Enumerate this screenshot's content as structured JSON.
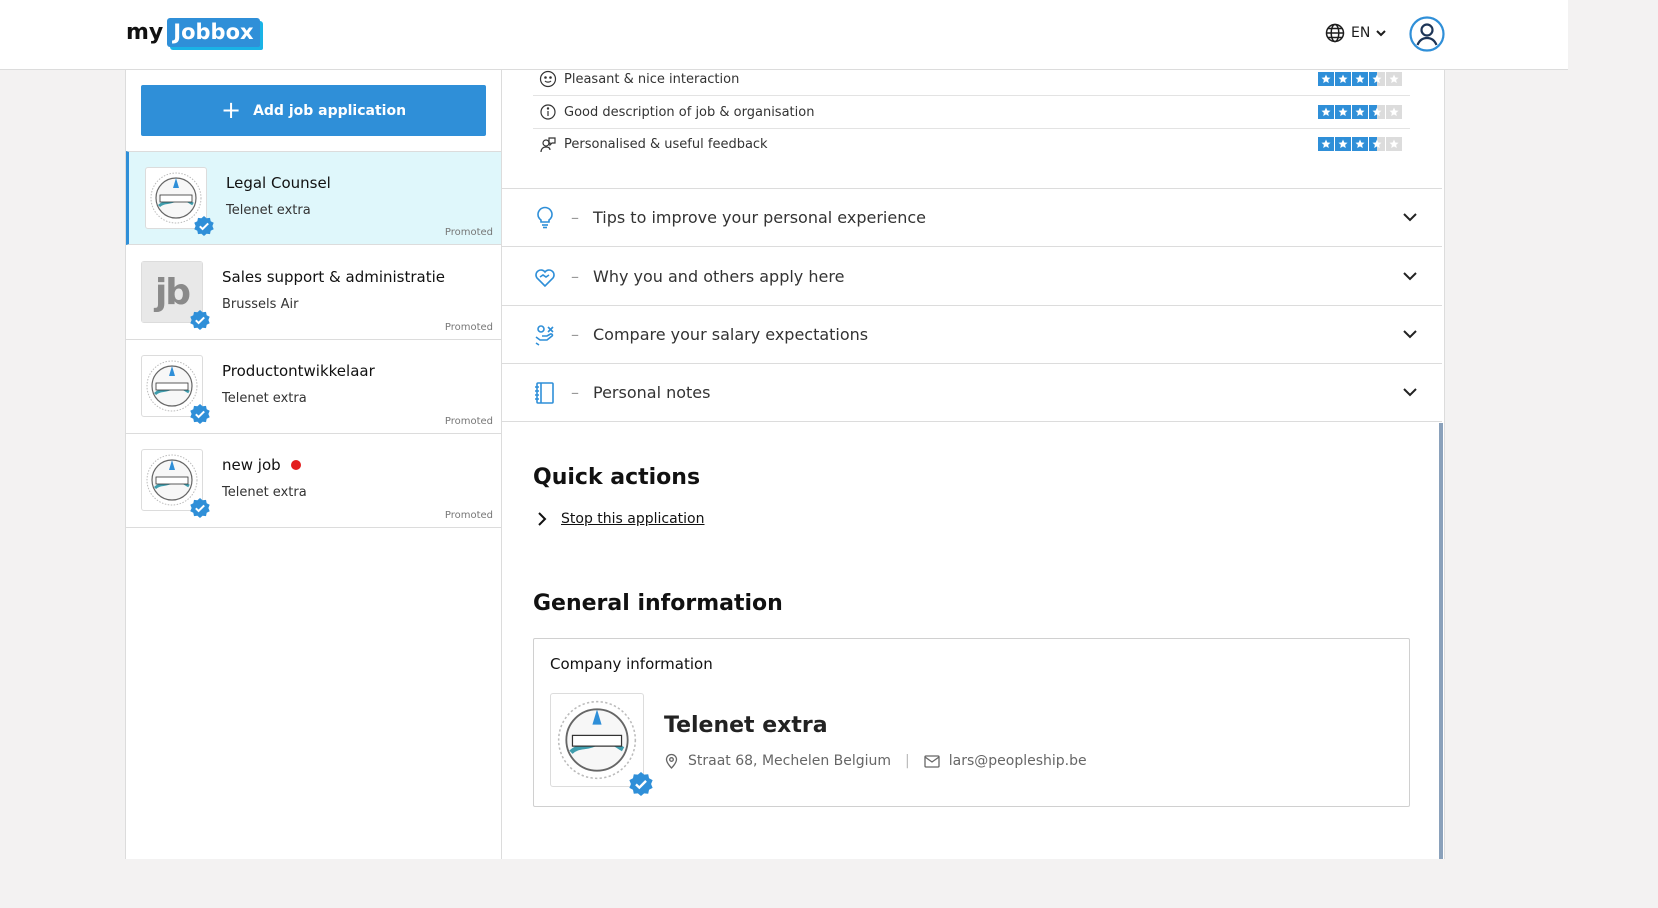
{
  "header": {
    "logo_my": "my",
    "logo_box": "Jobbox",
    "language": "EN"
  },
  "sidebar": {
    "add_button_label": "Add job application",
    "jobs": [
      {
        "title": "Legal Counsel",
        "company": "Telenet extra",
        "badge": "Promoted",
        "active": true
      },
      {
        "title": "Sales support & administratie",
        "company": "Brussels Air",
        "badge": "Promoted",
        "logo_text": "jb"
      },
      {
        "title": "Productontwikkelaar",
        "company": "Telenet extra",
        "badge": "Promoted"
      },
      {
        "title": "new job",
        "company": "Telenet extra",
        "badge": "Promoted",
        "new_indicator": true
      }
    ]
  },
  "ratings": [
    {
      "label": "Pleasant & nice interaction",
      "icon": "smiley-icon",
      "stars": 3.5
    },
    {
      "label": "Good description of job & organisation",
      "icon": "info-icon",
      "stars": 3.5
    },
    {
      "label": "Personalised & useful feedback",
      "icon": "feedback-icon",
      "stars": 3.5
    }
  ],
  "accordions": [
    {
      "label": "Tips to improve your personal experience",
      "icon": "lightbulb-icon"
    },
    {
      "label": "Why you and others apply here",
      "icon": "heart-hands-icon"
    },
    {
      "label": "Compare your salary expectations",
      "icon": "salary-hand-icon"
    },
    {
      "label": "Personal notes",
      "icon": "notebook-icon"
    }
  ],
  "quick_actions": {
    "title": "Quick actions",
    "stop_link": "Stop this application"
  },
  "general_info": {
    "title": "General information",
    "card_title": "Company information",
    "company_name": "Telenet extra",
    "address": "Straat 68, Mechelen Belgium",
    "email": "lars@peopleship.be",
    "separator": "|"
  },
  "colors": {
    "primary": "#2f8fd8",
    "active_bg": "#dff7fb",
    "new_dot": "#e31c1c"
  }
}
